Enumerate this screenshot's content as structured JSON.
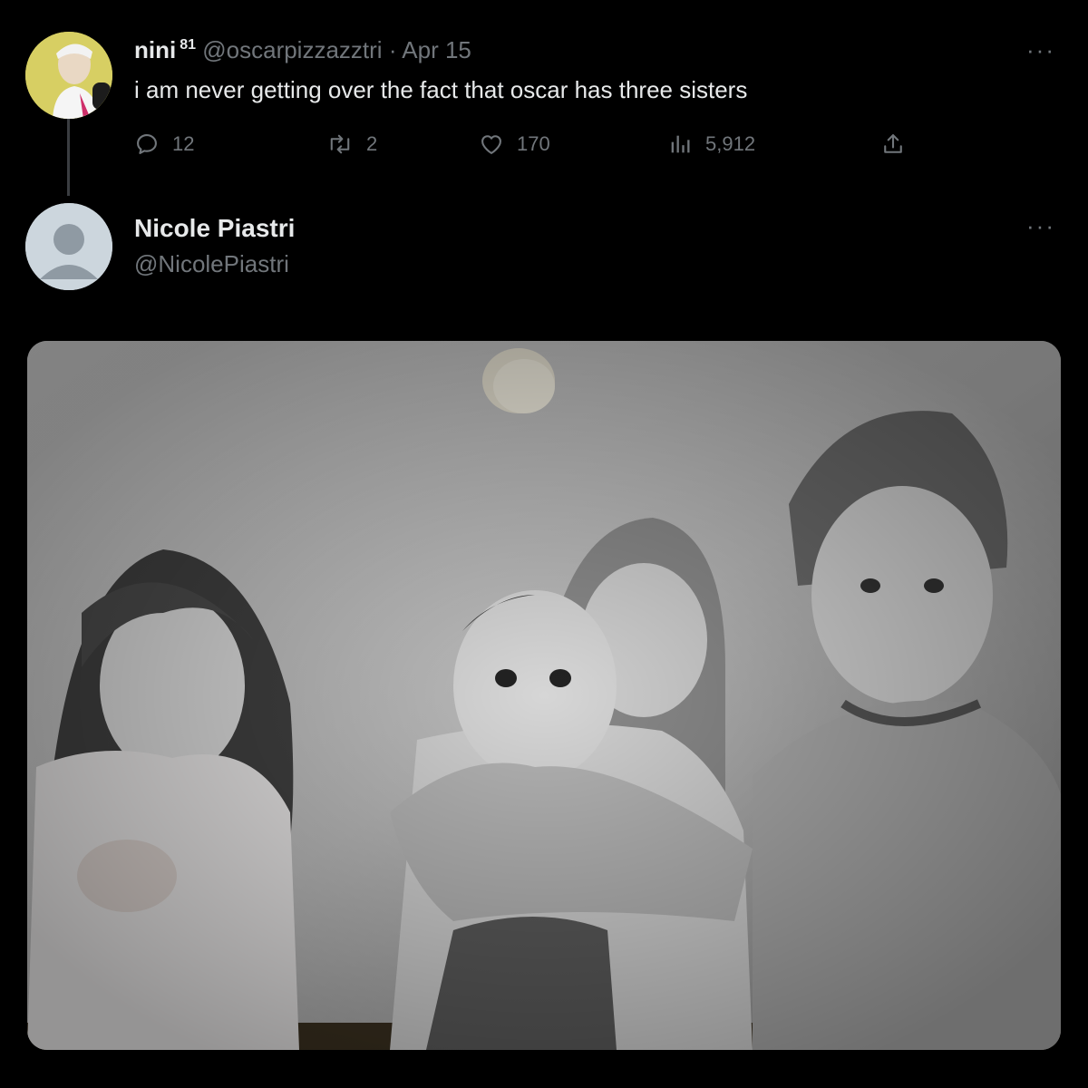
{
  "thread": {
    "tweet1": {
      "display_name": "nini",
      "badge": "81",
      "handle": "@oscarpizzazztri",
      "separator": "·",
      "date": "Apr 15",
      "text": "i am never getting over the fact that oscar has three sisters",
      "more": "···",
      "metrics": {
        "replies": "12",
        "retweets": "2",
        "likes": "170",
        "views": "5,912"
      },
      "icons": {
        "reply": "reply-icon",
        "retweet": "retweet-icon",
        "like": "heart-icon",
        "views": "analytics-icon",
        "share": "share-icon"
      }
    },
    "tweet2": {
      "display_name": "Nicole Piastri",
      "handle": "@NicolePiastri",
      "more": "···",
      "media": "black-and-white photo of four children sitting against a wall"
    }
  },
  "colors": {
    "background": "#000000",
    "primary_text": "#e7e9ea",
    "secondary_text": "#71767b",
    "thread_line": "#3a3d41"
  }
}
